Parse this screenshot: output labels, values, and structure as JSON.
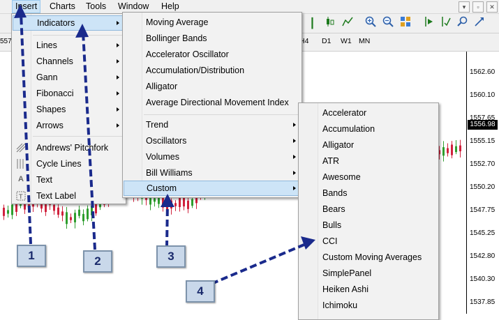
{
  "menubar": {
    "items": [
      "Insert",
      "Charts",
      "Tools",
      "Window",
      "Help"
    ],
    "active": "Insert",
    "window_controls": [
      "▾",
      "▫",
      "✕"
    ]
  },
  "timeframes": [
    "H4",
    "D1",
    "W1",
    "MN"
  ],
  "chart": {
    "prices": [
      "1562.60",
      "1560.10",
      "1557.65",
      "1555.15",
      "1552.70",
      "1550.20",
      "1547.75",
      "1545.25",
      "1542.80",
      "1540.30",
      "1537.85"
    ],
    "current_price": "1556.98",
    "left_price_fragment": "557"
  },
  "insert_menu": {
    "items": [
      {
        "label": "Indicators",
        "submenu": true,
        "highlighted": true
      },
      {
        "label": "Lines",
        "submenu": true
      },
      {
        "label": "Channels",
        "submenu": true
      },
      {
        "label": "Gann",
        "submenu": true
      },
      {
        "label": "Fibonacci",
        "submenu": true
      },
      {
        "label": "Shapes",
        "submenu": true
      },
      {
        "label": "Arrows",
        "submenu": true
      },
      {
        "label": "Andrews' Pitchfork"
      },
      {
        "label": "Cycle Lines"
      },
      {
        "label": "Text"
      },
      {
        "label": "Text Label"
      }
    ]
  },
  "indicators_menu": {
    "items": [
      {
        "label": "Moving Average"
      },
      {
        "label": "Bollinger Bands"
      },
      {
        "label": "Accelerator Oscillator"
      },
      {
        "label": "Accumulation/Distribution"
      },
      {
        "label": "Alligator"
      },
      {
        "label": "Average Directional Movement Index"
      },
      {
        "label": "Trend",
        "submenu": true
      },
      {
        "label": "Oscillators",
        "submenu": true
      },
      {
        "label": "Volumes",
        "submenu": true
      },
      {
        "label": "Bill Williams",
        "submenu": true
      },
      {
        "label": "Custom",
        "submenu": true,
        "highlighted": true
      }
    ]
  },
  "custom_menu": {
    "items": [
      "Accelerator",
      "Accumulation",
      "Alligator",
      "ATR",
      "Awesome",
      "Bands",
      "Bears",
      "Bulls",
      "CCI",
      "Custom Moving Averages",
      "SimplePanel",
      "Heiken Ashi",
      "Ichimoku"
    ]
  },
  "callouts": [
    "1",
    "2",
    "3",
    "4"
  ],
  "colors": {
    "callout_fill": "#c9d8ea",
    "arrow": "#1a2a8c",
    "bull": "#2e9e2e",
    "bear": "#d0213c",
    "highlight": "#cde4f7"
  }
}
